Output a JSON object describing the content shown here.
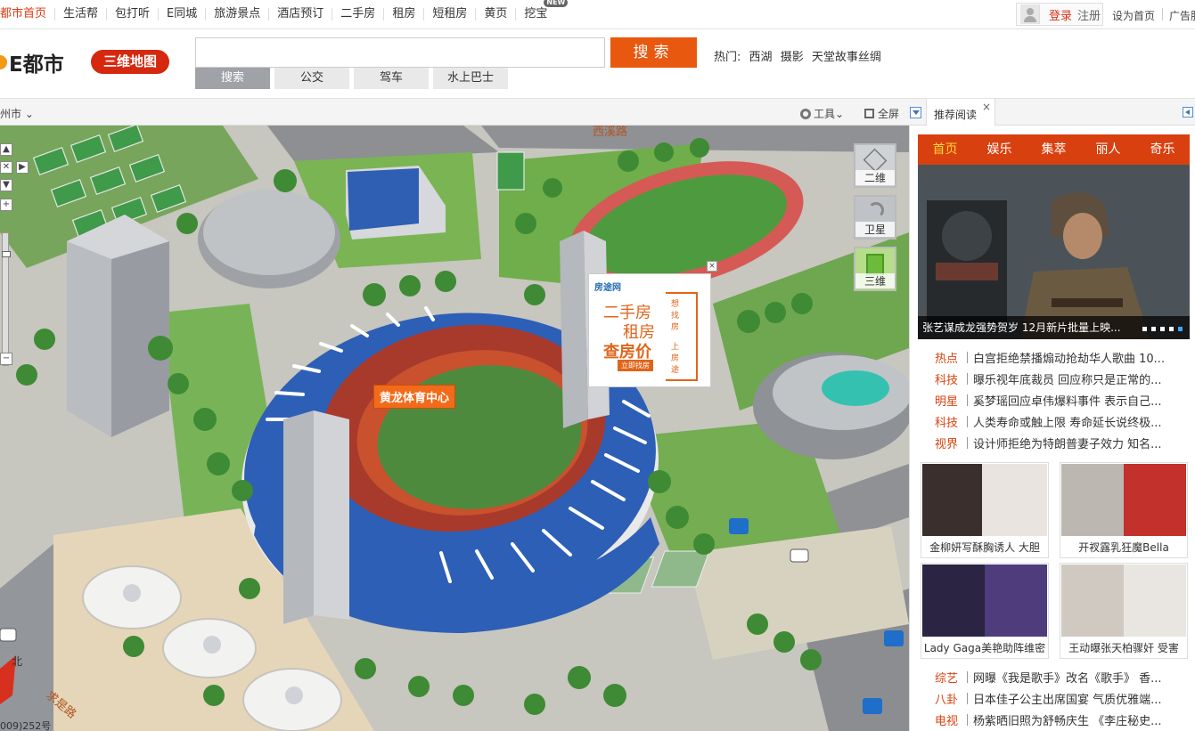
{
  "topnav": {
    "items": [
      "都市首页",
      "生活帮",
      "包打听",
      "E同城",
      "旅游景点",
      "酒店预订",
      "二手房",
      "租房",
      "短租房",
      "黄页",
      "挖宝"
    ],
    "new_badge": "NEW",
    "login": "登录",
    "register": "注册",
    "set_home": "设为首页",
    "ads": "广告服"
  },
  "header": {
    "logo_text": "E都市",
    "logo_badge": "三维地图",
    "search_placeholder": "",
    "search_button": "搜索",
    "hot_label": "热门:",
    "hot_terms": [
      "西湖",
      "摄影",
      "天堂故事丝绸"
    ],
    "tabs": [
      "搜索",
      "公交",
      "驾车",
      "水上巴士"
    ]
  },
  "toolbar": {
    "city": "州市",
    "tools": "工具",
    "fullscreen": "全屏",
    "recommend_tab": "推荐阅读",
    "recommend_close": "×"
  },
  "map": {
    "place_label": "黄龙体育中心",
    "road_top": "西溪路",
    "road_bottom_left": "求是路",
    "north": "北",
    "coord": "009)252号",
    "modes": [
      {
        "label": "二维",
        "icon": "map-2d-icon"
      },
      {
        "label": "卫星",
        "icon": "satellite-icon"
      },
      {
        "label": "三维",
        "icon": "map-3d-icon"
      }
    ],
    "ad": {
      "brand": "房途网",
      "line1": "二手房",
      "line2": "租房",
      "line3": "查房价",
      "button": "立即找房",
      "vert1": "想找房",
      "vert2": "上房途",
      "close": "×"
    }
  },
  "panel": {
    "channels": [
      "首页",
      "娱乐",
      "集萃",
      "丽人",
      "奇乐"
    ],
    "featured_caption": "张艺谋成龙强势贺岁 12月新片批量上映...",
    "news": [
      {
        "cat": "热点",
        "title": "白宫拒绝禁播煽动抢劫华人歌曲 10..."
      },
      {
        "cat": "科技",
        "title": "曝乐视年底裁员 回应称只是正常的..."
      },
      {
        "cat": "明星",
        "title": "奚梦瑶回应卓伟爆料事件 表示自己..."
      },
      {
        "cat": "科技",
        "title": "人类寿命或触上限 寿命延长说终极..."
      },
      {
        "cat": "视界",
        "title": "设计师拒绝为特朗普妻子效力 知名..."
      }
    ],
    "thumbs": [
      {
        "caption": "金柳妍写酥胸诱人 大胆"
      },
      {
        "caption": "开衩露乳狂魔Bella"
      },
      {
        "caption": "Lady Gaga美艳助阵维密"
      },
      {
        "caption": "王动曝张天柏骤奸 受害"
      }
    ],
    "news2": [
      {
        "cat": "综艺",
        "title": "网曝《我是歌手》改名《歌手》 香..."
      },
      {
        "cat": "八卦",
        "title": "日本佳子公主出席国宴 气质优雅端..."
      },
      {
        "cat": "电视",
        "title": "杨紫晒旧照为舒畅庆生 《李庄秘史..."
      }
    ]
  }
}
